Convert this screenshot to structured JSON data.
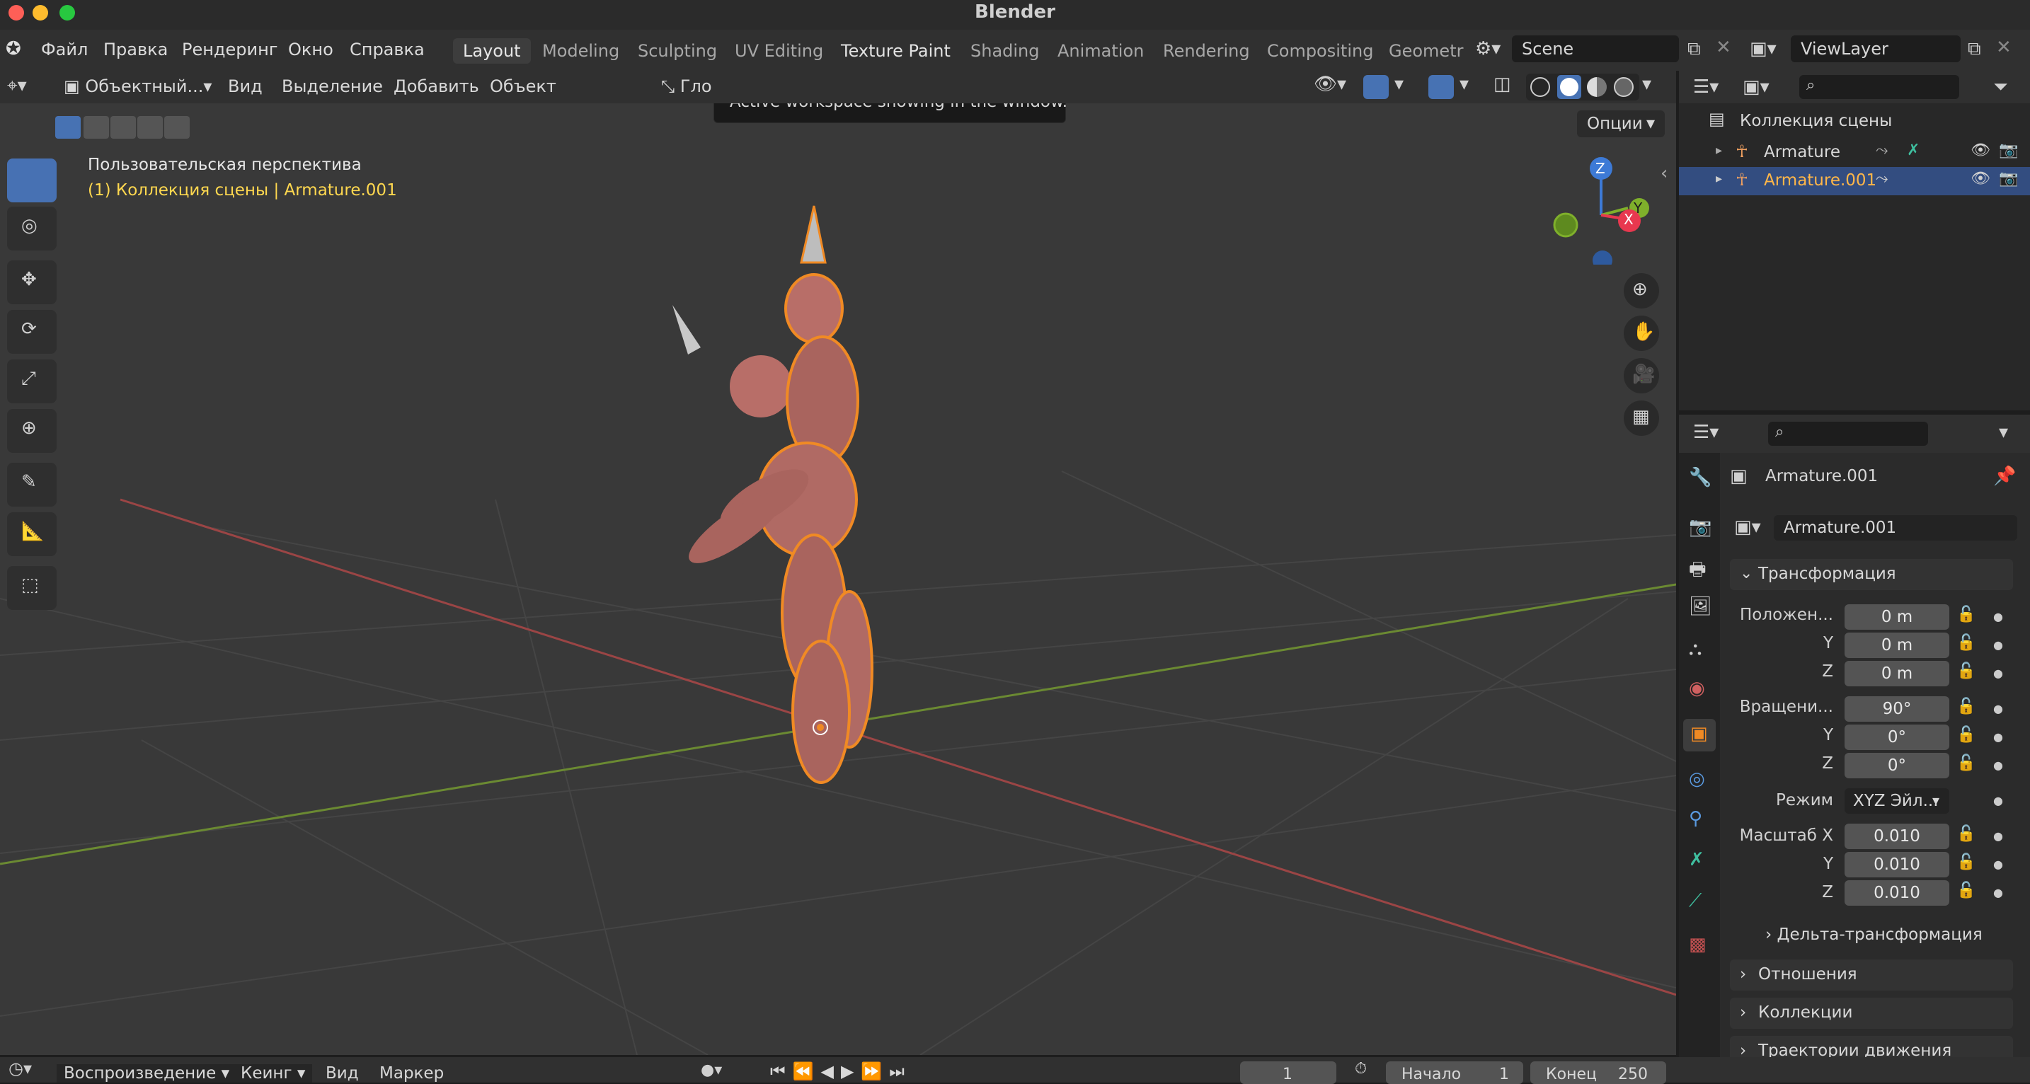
{
  "app_title": "Blender",
  "menu": [
    "Файл",
    "Правка",
    "Рендеринг",
    "Окно",
    "Справка"
  ],
  "workspaces": [
    "Layout",
    "Modeling",
    "Sculpting",
    "UV Editing",
    "Texture Paint",
    "Shading",
    "Animation",
    "Rendering",
    "Compositing",
    "Geometr"
  ],
  "active_workspace": "Layout",
  "scene": "Scene",
  "view_layer": "ViewLayer",
  "viewport_header": {
    "mode": "Объектный...",
    "menus": [
      "Вид",
      "Выделение",
      "Добавить",
      "Объект"
    ],
    "orientation": "Гло",
    "options": "Опции"
  },
  "tooltip": "Active workspace showing in the window.",
  "viewport": {
    "view_name": "Пользовательская перспектива",
    "collection_info": "(1) Коллекция сцены | Armature.001"
  },
  "gizmo": {
    "z": "Z",
    "y": "Y",
    "x": "X"
  },
  "outliner": {
    "root": "Коллекция сцены",
    "items": [
      {
        "name": "Armature",
        "selected": false
      },
      {
        "name": "Armature.001",
        "selected": true
      }
    ]
  },
  "properties": {
    "object_name": "Armature.001",
    "datablock": "Armature.001",
    "transform_title": "Трансформация",
    "location_label": "Положен...",
    "location": [
      "0 m",
      "0 m",
      "0 m"
    ],
    "rotation_label": "Вращени...",
    "rotation": [
      "90°",
      "0°",
      "0°"
    ],
    "mode_label": "Режим",
    "mode_value": "XYZ Эйл...",
    "scale_label": "Масштаб X",
    "scale": [
      "0.010",
      "0.010",
      "0.010"
    ],
    "axis_y": "Y",
    "axis_z": "Z",
    "delta": "Дельта-трансформация",
    "relations": "Отношения",
    "collections": "Коллекции",
    "motion_paths": "Траектории движения"
  },
  "timeline": {
    "menus": [
      "Воспроизведение",
      "Кеинг",
      "Вид",
      "Маркер"
    ],
    "current_frame": "1",
    "start_label": "Начало",
    "start": "1",
    "end_label": "Конец",
    "end": "250"
  },
  "colors": {
    "accent": "#4772b3",
    "selection": "#f08a24",
    "active_text": "#ffd84f"
  }
}
